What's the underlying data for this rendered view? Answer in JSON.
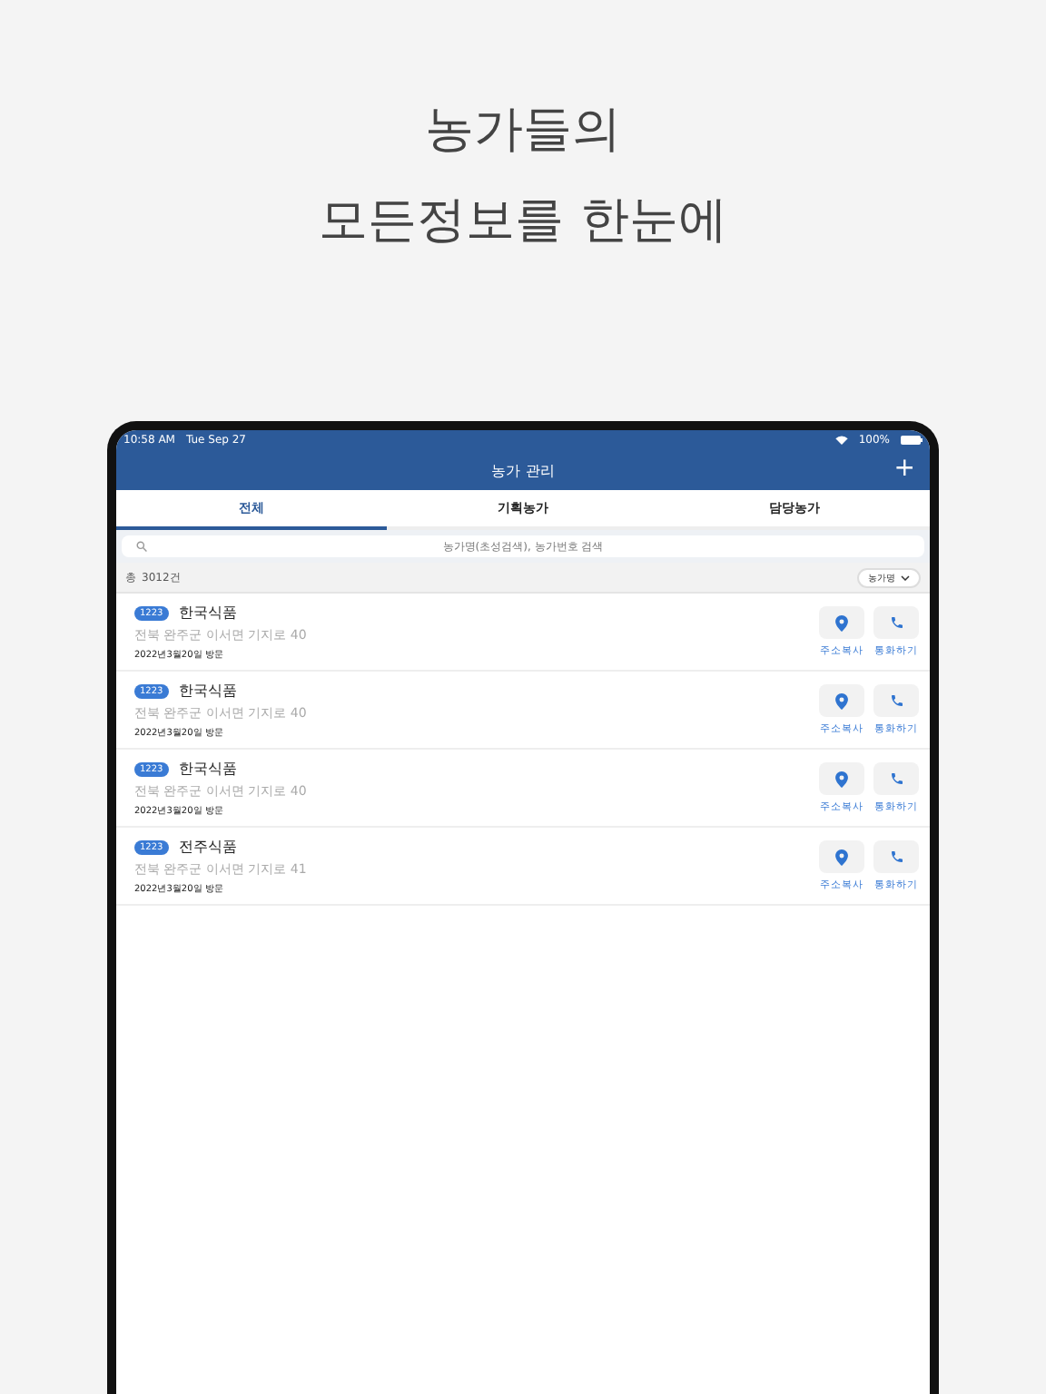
{
  "headline": [
    "농가들의",
    "모든정보를 한눈에"
  ],
  "status_bar": {
    "time": "10:58 AM",
    "date": "Tue Sep 27",
    "battery": "100%"
  },
  "header": {
    "title": "농가 관리",
    "add": "+"
  },
  "tabs": [
    {
      "label": "전체",
      "selected": true
    },
    {
      "label": "기획농가",
      "selected": false
    },
    {
      "label": "담당농가",
      "selected": false
    }
  ],
  "search": {
    "placeholder": "농가명(초성검색), 농가번호 검색"
  },
  "summary": {
    "prefix": "총",
    "count": "3012건",
    "sort": "농가명"
  },
  "farms": [
    {
      "code": "1223",
      "name": "한국식품",
      "address": "전북 완주군  이서면 기지로 40",
      "visit": "2022년3월20일 방문",
      "actions": [
        "주소복사",
        "통화하기"
      ]
    },
    {
      "code": "1223",
      "name": "한국식품",
      "address": "전북 완주군  이서면 기지로 40",
      "visit": "2022년3월20일 방문",
      "actions": [
        "주소복사",
        "통화하기"
      ]
    },
    {
      "code": "1223",
      "name": "한국식품",
      "address": "전북 완주군  이서면 기지로 40",
      "visit": "2022년3월20일 방문",
      "actions": [
        "주소복사",
        "통화하기"
      ]
    },
    {
      "code": "1223",
      "name": "전주식품",
      "address": "전북 완주군  이서면 기지로 41",
      "visit": "2022년3월20일 방문",
      "actions": [
        "주소복사",
        "통화하기"
      ]
    }
  ]
}
